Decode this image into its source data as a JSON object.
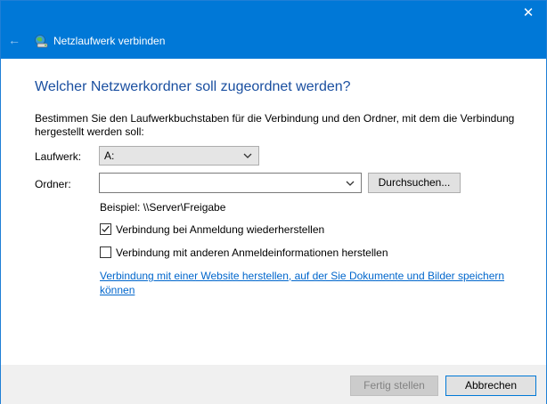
{
  "window": {
    "title": "Netzlaufwerk verbinden",
    "close_glyph": "✕",
    "back_glyph": "←",
    "accent": "#0078d7"
  },
  "main": {
    "heading": "Welcher Netzwerkordner soll zugeordnet werden?",
    "description": "Bestimmen Sie den Laufwerkbuchstaben für die Verbindung und den Ordner, mit dem die Verbindung hergestellt werden soll:",
    "drive_label": "Laufwerk:",
    "drive_value": "A:",
    "folder_label": "Ordner:",
    "folder_value": "",
    "browse_label": "Durchsuchen...",
    "example": "Beispiel: \\\\Server\\Freigabe",
    "reconnect_label": "Verbindung bei Anmeldung wiederherstellen",
    "reconnect_checked": true,
    "other_creds_label": "Verbindung mit anderen Anmeldeinformationen herstellen",
    "other_creds_checked": false,
    "website_link": "Verbindung mit einer Website herstellen, auf der Sie Dokumente und Bilder speichern können"
  },
  "footer": {
    "finish_label": "Fertig stellen",
    "cancel_label": "Abbrechen"
  },
  "icons": {
    "network_drive": "network-drive-icon",
    "dropdown": "chevron-down-icon",
    "check": "checkmark-icon"
  }
}
